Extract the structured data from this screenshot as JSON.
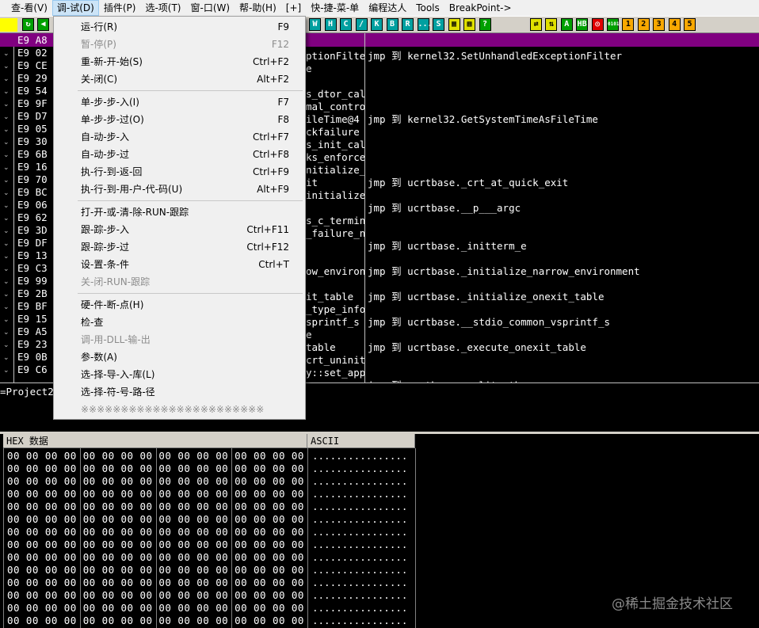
{
  "menubar": {
    "items": [
      "查-看(V)",
      "调-试(D)",
      "插件(P)",
      "选-项(T)",
      "窗-口(W)",
      "帮-助(H)",
      "[+]",
      "快-捷-菜-单",
      "编程达人",
      "Tools",
      "BreakPoint->"
    ],
    "active_index": 1
  },
  "toolbar": {
    "left_buttons": [
      "↻",
      "◀"
    ],
    "letter_buttons": [
      "W",
      "H",
      "C",
      "/",
      "K",
      "B",
      "R",
      "...",
      "S",
      "▦",
      "▦",
      "?"
    ],
    "right_buttons": [
      "⇄",
      "⇅",
      "A",
      "HB",
      "◎",
      "0101",
      "1",
      "2",
      "3",
      "4",
      "5"
    ]
  },
  "cpu": {
    "hex_rows": [
      "E9 A8",
      "E9 02",
      "E9 CE",
      "E9 29",
      "E9 54",
      "E9 9F",
      "E9 D7",
      "E9 05",
      "E9 30",
      "E9 6B",
      "E9 16",
      "E9 70",
      "E9 BC",
      "E9 06",
      "E9 62",
      "E9 3D",
      "E9 DF",
      "E9 13",
      "E9 C3",
      "E9 99",
      "E9 2B",
      "E9 BF",
      "E9 15",
      "E9 A5",
      "E9 23",
      "E9 0B",
      "E9 C6"
    ],
    "asm_rows": [
      "ptionFilte",
      "e",
      "",
      "s_dtor_cal",
      "mal_contro",
      "ileTime@4",
      "ckfailure",
      "s_init_cal",
      "ks_enforce",
      "nitialize_",
      "it",
      "initialize",
      "",
      "s_c_termin",
      "_failure_n",
      "",
      "",
      "ow_environ",
      "",
      "it_table",
      "_type_info",
      "sprintf_s",
      "e",
      "table",
      "crt_uninit",
      "y::set_app"
    ],
    "comments": [
      {
        "row": 0,
        "text": "jmp 到 kernel32.SetUnhandledExceptionFilter"
      },
      {
        "row": 5,
        "text": "jmp 到 kernel32.GetSystemTimeAsFileTime"
      },
      {
        "row": 10,
        "text": "jmp 到 ucrtbase._crt_at_quick_exit"
      },
      {
        "row": 12,
        "text": "jmp 到 ucrtbase.__p___argc"
      },
      {
        "row": 15,
        "text": "jmp 到 ucrtbase._initterm_e"
      },
      {
        "row": 17,
        "text": "jmp 到 ucrtbase._initialize_narrow_environment"
      },
      {
        "row": 19,
        "text": "jmp 到 ucrtbase._initialize_onexit_table"
      },
      {
        "row": 21,
        "text": "jmp 到 ucrtbase.__stdio_common_vsprintf_s"
      },
      {
        "row": 23,
        "text": "jmp 到 ucrtbase._execute_onexit_table"
      },
      {
        "row": 26,
        "text": "jmp 到 ucrtbase._splitpath_s"
      }
    ]
  },
  "info": {
    "text": "=Project2"
  },
  "dump": {
    "hex_header": "HEX 数据",
    "ascii_header": "ASCII",
    "row_hex": "00 00 00 00 00 00 00 00 00 00 00 00 00 00 00 00",
    "row_ascii": "................",
    "row_count": 14
  },
  "debug_menu": {
    "items": [
      {
        "label": "运-行(R)",
        "shortcut": "F9",
        "disabled": false
      },
      {
        "label": "暂-停(P)",
        "shortcut": "F12",
        "disabled": true
      },
      {
        "label": "重-新-开-始(S)",
        "shortcut": "Ctrl+F2",
        "disabled": false
      },
      {
        "label": "关-闭(C)",
        "shortcut": "Alt+F2",
        "disabled": false
      },
      {
        "sep": true
      },
      {
        "label": "单-步-步-入(I)",
        "shortcut": "F7",
        "disabled": false
      },
      {
        "label": "单-步-步-过(O)",
        "shortcut": "F8",
        "disabled": false
      },
      {
        "label": "自-动-步-入",
        "shortcut": "Ctrl+F7",
        "disabled": false
      },
      {
        "label": "自-动-步-过",
        "shortcut": "Ctrl+F8",
        "disabled": false
      },
      {
        "label": "执-行-到-返-回",
        "shortcut": "Ctrl+F9",
        "disabled": false
      },
      {
        "label": "执-行-到-用-户-代-码(U)",
        "shortcut": "Alt+F9",
        "disabled": false
      },
      {
        "sep": true
      },
      {
        "label": "打-开-或-清-除-RUN-跟踪",
        "shortcut": "",
        "disabled": false
      },
      {
        "label": "跟-踪-步-入",
        "shortcut": "Ctrl+F11",
        "disabled": false
      },
      {
        "label": "跟-踪-步-过",
        "shortcut": "Ctrl+F12",
        "disabled": false
      },
      {
        "label": "设-置-条-件",
        "shortcut": "Ctrl+T",
        "disabled": false
      },
      {
        "label": "关-闭-RUN-跟踪",
        "shortcut": "",
        "disabled": true
      },
      {
        "sep": true
      },
      {
        "label": "硬-件-断-点(H)",
        "shortcut": "",
        "disabled": false
      },
      {
        "label": "检-查",
        "shortcut": "",
        "disabled": false
      },
      {
        "label": "调-用-DLL-输-出",
        "shortcut": "",
        "disabled": true
      },
      {
        "label": "参-数(A)",
        "shortcut": "",
        "disabled": false
      },
      {
        "label": "选-择-导-入-库(L)",
        "shortcut": "",
        "disabled": false
      },
      {
        "label": "选-择-符-号-路-径",
        "shortcut": "",
        "disabled": false
      },
      {
        "label": "※※※※※※※※※※※※※※※※※※※※※※※",
        "shortcut": "",
        "disabled": true
      }
    ]
  },
  "watermark": "@稀土掘金技术社区"
}
